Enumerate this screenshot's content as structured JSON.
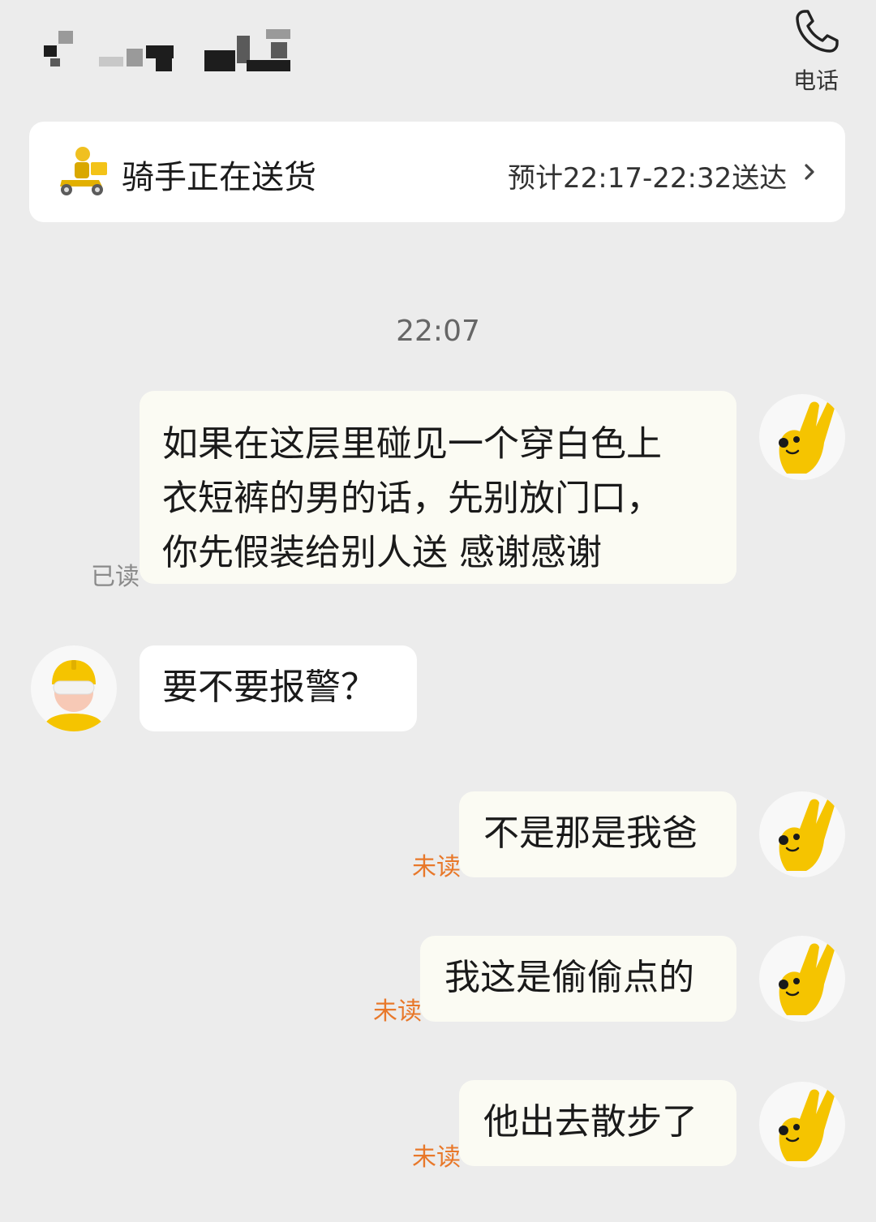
{
  "header": {
    "contact_name": "(blurred)",
    "phone_label": "电话"
  },
  "delivery": {
    "status": "骑手正在送货",
    "eta": "预计22:17-22:32送达",
    "icon": "rider-scooter-icon"
  },
  "chat": {
    "timestamp": "22:07",
    "messages": [
      {
        "side": "right",
        "lines": [
          "如果在这层里碰见一个穿白色上",
          "衣短裤的男的话，先别放门口，",
          "你先假装给别人送  感谢感谢"
        ],
        "status": "已读"
      },
      {
        "side": "left",
        "lines": [
          "要不要报警？"
        ]
      },
      {
        "side": "right",
        "lines": [
          "不是那是我爸"
        ],
        "status": "未读"
      },
      {
        "side": "right",
        "lines": [
          "我这是偷偷点的"
        ],
        "status": "未读"
      },
      {
        "side": "right",
        "lines": [
          "他出去散步了"
        ],
        "status": "未读"
      }
    ]
  },
  "colors": {
    "background": "#ececec",
    "bubble_out": "#fbfbf3",
    "bubble_in": "#ffffff",
    "unread": "#e8782a",
    "read": "#8a8a8a",
    "avatar_yellow": "#f5c400"
  }
}
